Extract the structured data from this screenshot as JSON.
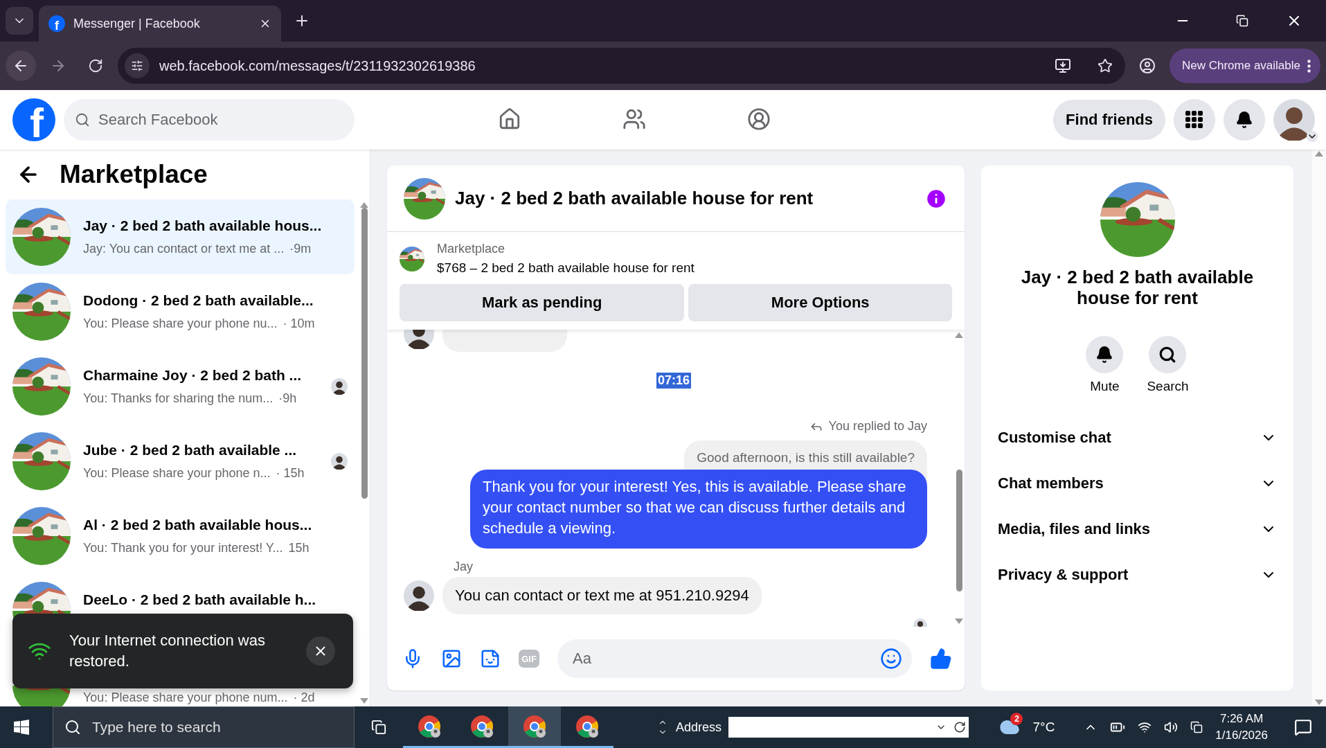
{
  "browser": {
    "tabs": [
      {
        "favicon": "f",
        "title": "Messenger | Facebook",
        "selected": true
      }
    ],
    "url": "web.facebook.com/messages/t/2311932302619386",
    "update_button": "New Chrome available"
  },
  "header": {
    "logo": "f",
    "search": {
      "placeholder": "Search Facebook"
    },
    "nav": [
      {
        "kind": "home",
        "selected": false
      },
      {
        "kind": "friends",
        "selected": false
      },
      {
        "kind": "groups",
        "selected": false
      }
    ],
    "find_friends": "Find friends"
  },
  "sidebar": {
    "title": "Marketplace",
    "conversations": [
      {
        "title": "Jay · 2 bed 2 bath available hous...",
        "preview": "Jay: You can contact or text me at ...",
        "time": "·9m",
        "seen_avatar": false,
        "selected": true
      },
      {
        "title": "Dodong · 2 bed 2 bath available...",
        "preview": "You: Please share your phone nu...",
        "time": "· 10m",
        "seen_avatar": false,
        "selected": false
      },
      {
        "title": "Charmaine Joy · 2 bed 2 bath ...",
        "preview": "You: Thanks for sharing the num...",
        "time": "·9h",
        "seen_avatar": true,
        "selected": false
      },
      {
        "title": "Jube · 2 bed 2 bath available ...",
        "preview": "You: Please share your phone n...",
        "time": "· 15h",
        "seen_avatar": true,
        "selected": false
      },
      {
        "title": "Al · 2 bed 2 bath available hous...",
        "preview": "You: Thank you for your interest! Y...",
        "time": "15h",
        "seen_avatar": false,
        "selected": false
      },
      {
        "title": "DeeLo · 2 bed 2 bath available h...",
        "seen_avatar": false,
        "selected": false
      },
      {
        "preview": "You: Please share your phone num...",
        "time": "· 2d",
        "seen_avatar": false,
        "selected": false
      }
    ],
    "toast": {
      "text": "Your Internet connection was restored."
    }
  },
  "chat": {
    "title": "Jay · 2 bed 2 bath available house for rent",
    "listing": {
      "label": "Marketplace",
      "text": "$768 – 2 bed 2 bath available house for rent"
    },
    "actions": [
      "Mark as pending",
      "More Options"
    ],
    "messages": [
      {
        "kind": "partial"
      },
      {
        "kind": "time",
        "text": "07:16",
        "highlighted": true
      },
      {
        "kind": "reply_note",
        "text": "You replied to Jay"
      },
      {
        "kind": "quoted",
        "text": "Good afternoon, is this still available?"
      },
      {
        "kind": "outgoing",
        "text": "Thank you for your interest! Yes, this is available. Please share your contact number so that we can discuss further details and schedule a viewing."
      },
      {
        "kind": "sender",
        "text": "Jay"
      },
      {
        "kind": "incoming",
        "text": "You can contact or text me at 951.210.9294"
      },
      {
        "kind": "seen"
      }
    ],
    "composer": {
      "placeholder": "Aa",
      "gif": "GIF"
    }
  },
  "details": {
    "title": "Jay · 2 bed 2 bath available house for rent",
    "actions": [
      {
        "kind": "mute",
        "label": "Mute"
      },
      {
        "kind": "search",
        "label": "Search"
      }
    ],
    "sections": [
      {
        "label": "Customise chat",
        "expanded": false
      },
      {
        "label": "Chat members",
        "expanded": false
      },
      {
        "label": "Media, files and links",
        "expanded": false
      },
      {
        "label": "Privacy & support",
        "expanded": false
      }
    ]
  },
  "taskbar": {
    "search": {
      "placeholder": "Type here to search"
    },
    "apps": [
      {
        "selected": false
      },
      {
        "selected": false
      },
      {
        "selected": true
      },
      {
        "selected": false
      }
    ],
    "address_label": "Address",
    "weather": {
      "badge": "2",
      "temp": "7°C"
    },
    "time": "7:26 AM",
    "date": "1/16/2026"
  }
}
